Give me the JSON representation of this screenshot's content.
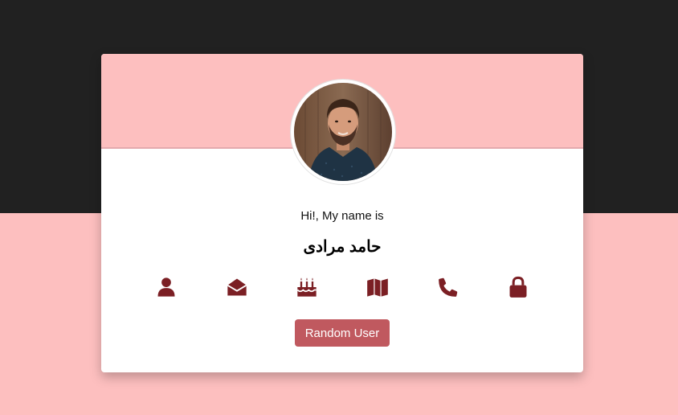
{
  "profile": {
    "greeting": "Hi!, My name is",
    "name": "حامد مرادی",
    "avatar_alt": "User photo"
  },
  "icons": [
    {
      "name": "user-icon"
    },
    {
      "name": "email-icon"
    },
    {
      "name": "birthday-cake-icon"
    },
    {
      "name": "map-icon"
    },
    {
      "name": "phone-icon"
    },
    {
      "name": "lock-icon"
    }
  ],
  "actions": {
    "random_user_label": "Random User"
  },
  "colors": {
    "page_top": "#212121",
    "page_bottom": "#fdbfbf",
    "card_header": "#fdbfbf",
    "icon": "#7b1f24",
    "button": "#c0595f"
  }
}
